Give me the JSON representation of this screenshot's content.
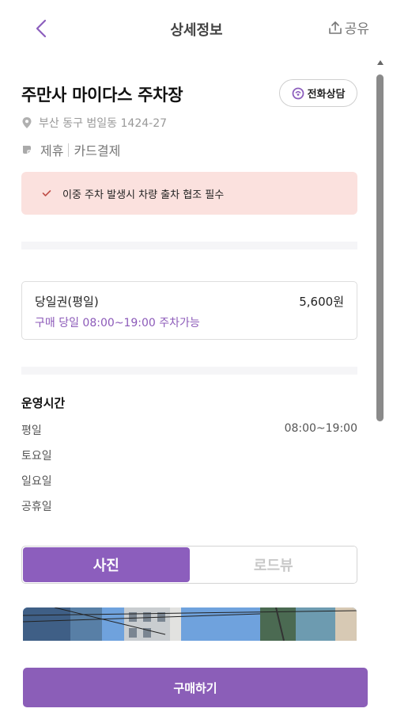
{
  "header": {
    "title": "상세정보",
    "share_label": "공유"
  },
  "lot": {
    "name": "주만사 마이다스 주차장",
    "call_label": "전화상담",
    "address": "부산 동구 범일동 1424-27",
    "tags": [
      "제휴",
      "카드결제"
    ]
  },
  "notice": {
    "text": "이중 주차 발생시 차량 출차 협조 필수"
  },
  "ticket": {
    "name": "당일권(평일)",
    "price": "5,600원",
    "condition": "구매 당일 08:00~19:00 주차가능"
  },
  "hours": {
    "title": "운영시간",
    "rows": [
      {
        "day": "평일",
        "time": "08:00~19:00"
      },
      {
        "day": "토요일",
        "time": ""
      },
      {
        "day": "일요일",
        "time": ""
      },
      {
        "day": "공휴일",
        "time": ""
      }
    ]
  },
  "media_tabs": {
    "photo_label": "사진",
    "roadview_label": "로드뷰"
  },
  "footer": {
    "buy_label": "구매하기"
  },
  "colors": {
    "accent": "#8b5eb8",
    "notice_bg": "#fbe1de"
  },
  "icons": [
    "back-icon",
    "share-icon",
    "phone-chat-icon",
    "location-pin-icon",
    "tag-icon",
    "check-icon"
  ]
}
